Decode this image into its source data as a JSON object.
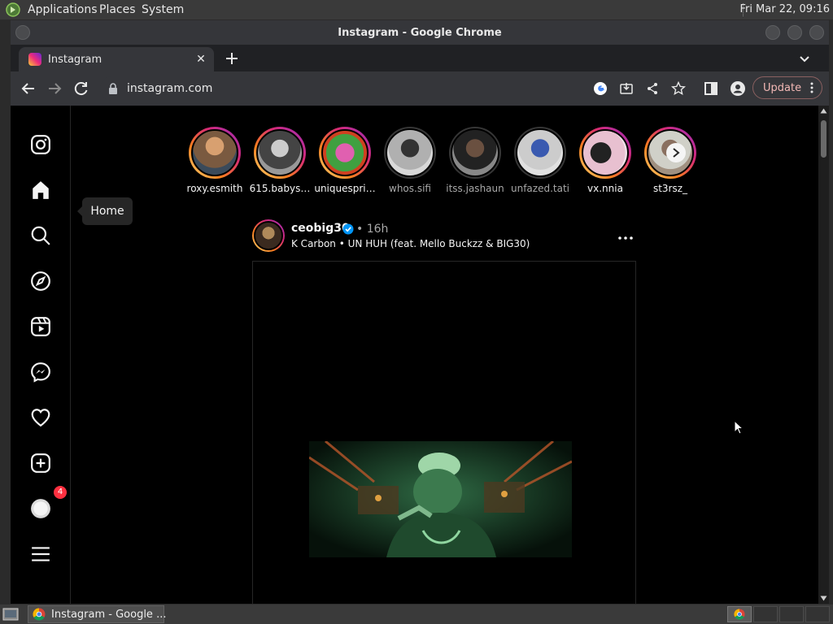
{
  "desktop": {
    "menus": [
      "Applications",
      "Places",
      "System"
    ],
    "clock": "Fri Mar 22, 09:16"
  },
  "window": {
    "title": "Instagram - Google Chrome"
  },
  "browser": {
    "tab_title": "Instagram",
    "url": "instagram.com",
    "update_label": "Update"
  },
  "sidebar": {
    "tooltip": "Home",
    "messages_badge": "4",
    "items": [
      "instagram-logo",
      "home",
      "search",
      "explore",
      "reels",
      "messages",
      "notifications",
      "create",
      "profile",
      "more"
    ]
  },
  "stories": [
    {
      "name": "roxy.esmith",
      "seen": false
    },
    {
      "name": "615.babys…",
      "seen": false
    },
    {
      "name": "uniquespri…",
      "seen": false
    },
    {
      "name": "whos.sifi",
      "seen": true
    },
    {
      "name": "itss.jashaun",
      "seen": true
    },
    {
      "name": "unfazed.tati",
      "seen": true
    },
    {
      "name": "vx.nnia",
      "seen": false
    },
    {
      "name": "st3rsz_",
      "seen": false
    }
  ],
  "post": {
    "username": "ceobig30",
    "time": "• 16h",
    "audio": "K Carbon • UN HUH (feat. Mello Buckzz & BIG30)"
  },
  "taskbar": {
    "task_label": "Instagram - Google ..."
  },
  "colors": {
    "story_ring": "#d62976",
    "badge": "#ff3040",
    "verified": "#0095f6"
  }
}
